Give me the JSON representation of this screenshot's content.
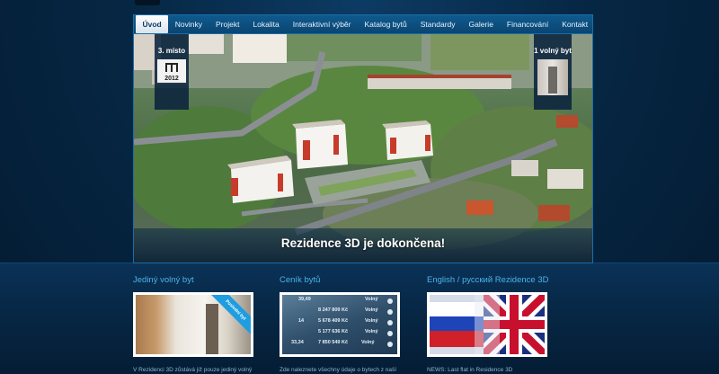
{
  "nav": {
    "items": [
      {
        "label": "Úvod",
        "active": true
      },
      {
        "label": "Novinky"
      },
      {
        "label": "Projekt"
      },
      {
        "label": "Lokalita"
      },
      {
        "label": "Interaktivní výběr"
      },
      {
        "label": "Katalog bytů"
      },
      {
        "label": "Standardy"
      },
      {
        "label": "Galerie"
      },
      {
        "label": "Financování"
      },
      {
        "label": "Kontakt"
      }
    ]
  },
  "hero": {
    "caption": "Rezidence 3D je dokončena!",
    "award_rank": "3. místo",
    "award_year": "2012",
    "free_flat": "1 volný byt"
  },
  "columns": [
    {
      "title": "Jediný volný byt",
      "text": "V Rezidenci 3D zůstává již pouze jediný volný",
      "ribbon": "Poslední byt"
    },
    {
      "title": "Ceník bytů",
      "text": "Zde naleznete všechny údaje o bytech z naší",
      "price_rows": [
        {
          "area": "39,49",
          "price": "",
          "status": "Volný"
        },
        {
          "area": "",
          "price": "8 247 809 Kč",
          "status": "Volný"
        },
        {
          "area": "14",
          "price": "5 678 409 Kč",
          "status": "Volný"
        },
        {
          "area": "",
          "price": "5 177 636 Kč",
          "status": "Volný"
        },
        {
          "area": "33,34",
          "price": "7 850 549 Kč",
          "status": "Volný"
        }
      ]
    },
    {
      "title": "English / русский Rezidence 3D",
      "text": "NEWS: Last flat in Residence 3D"
    }
  ],
  "colors": {
    "accent": "#4db2ec",
    "nav_bg": "#0a4572",
    "page_bg": "#062744"
  }
}
